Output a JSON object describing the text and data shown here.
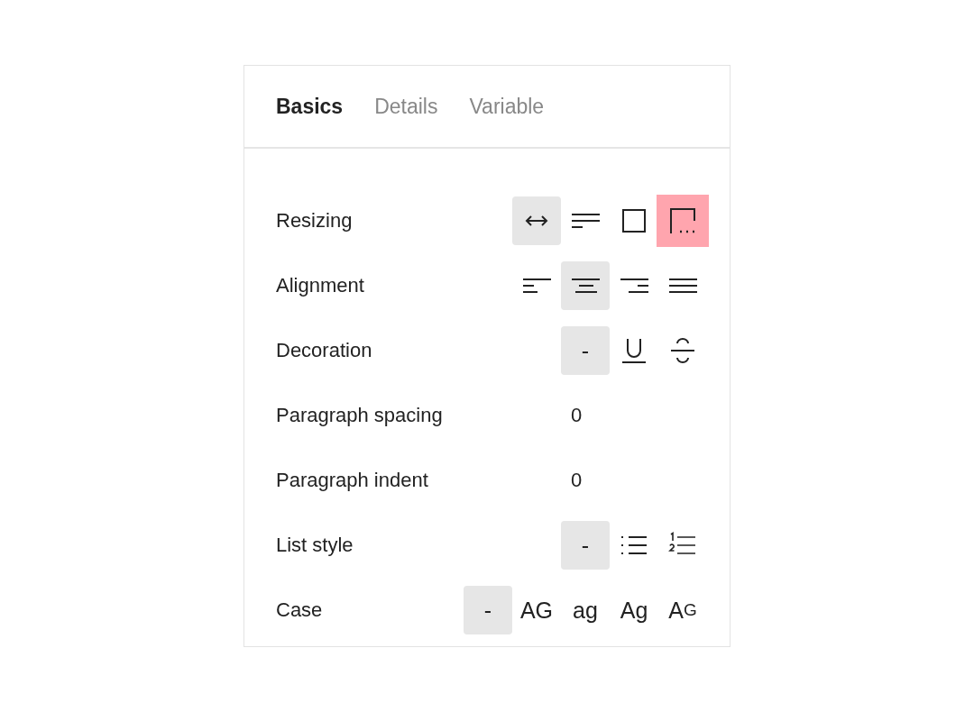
{
  "tabs": [
    {
      "label": "Basics",
      "selected": true
    },
    {
      "label": "Details",
      "selected": false
    },
    {
      "label": "Variable",
      "selected": false
    }
  ],
  "rows": [
    {
      "label": "Resizing",
      "kind": "options",
      "options": [
        {
          "kind": "arrows",
          "selected": true,
          "highlighted": false
        },
        {
          "kind": "wrap",
          "selected": false,
          "highlighted": false
        },
        {
          "kind": "square",
          "selected": false,
          "highlighted": false
        },
        {
          "kind": "truncate",
          "selected": false,
          "highlighted": true
        }
      ]
    },
    {
      "label": "Alignment",
      "kind": "options",
      "options": [
        {
          "kind": "left",
          "selected": false,
          "highlighted": false
        },
        {
          "kind": "center",
          "selected": true,
          "highlighted": false
        },
        {
          "kind": "right",
          "selected": false,
          "highlighted": false
        },
        {
          "kind": "justify",
          "selected": false,
          "highlighted": false
        }
      ]
    },
    {
      "label": "Decoration",
      "kind": "options",
      "options": [
        {
          "kind": "text",
          "label": "-",
          "selected": true,
          "highlighted": false
        },
        {
          "kind": "underline",
          "selected": false,
          "highlighted": false
        },
        {
          "kind": "strike",
          "selected": false,
          "highlighted": false
        }
      ]
    },
    {
      "label": "Paragraph spacing",
      "kind": "value",
      "value": "0"
    },
    {
      "label": "Paragraph indent",
      "kind": "value",
      "value": "0"
    },
    {
      "label": "List style",
      "kind": "options",
      "options": [
        {
          "kind": "text",
          "label": "-",
          "selected": true,
          "highlighted": false
        },
        {
          "kind": "bullets",
          "selected": false,
          "highlighted": false
        },
        {
          "kind": "numbers",
          "selected": false,
          "highlighted": false
        }
      ]
    },
    {
      "label": "Case",
      "kind": "options",
      "options": [
        {
          "kind": "text",
          "label": "-",
          "selected": true,
          "highlighted": false
        },
        {
          "kind": "text",
          "label": "AG",
          "selected": false,
          "highlighted": false
        },
        {
          "kind": "text",
          "label": "ag",
          "selected": false,
          "highlighted": false
        },
        {
          "kind": "text",
          "label": "Ag",
          "selected": false,
          "highlighted": false
        },
        {
          "kind": "smallcaps",
          "label": "AG",
          "selected": false,
          "highlighted": false
        }
      ]
    }
  ]
}
